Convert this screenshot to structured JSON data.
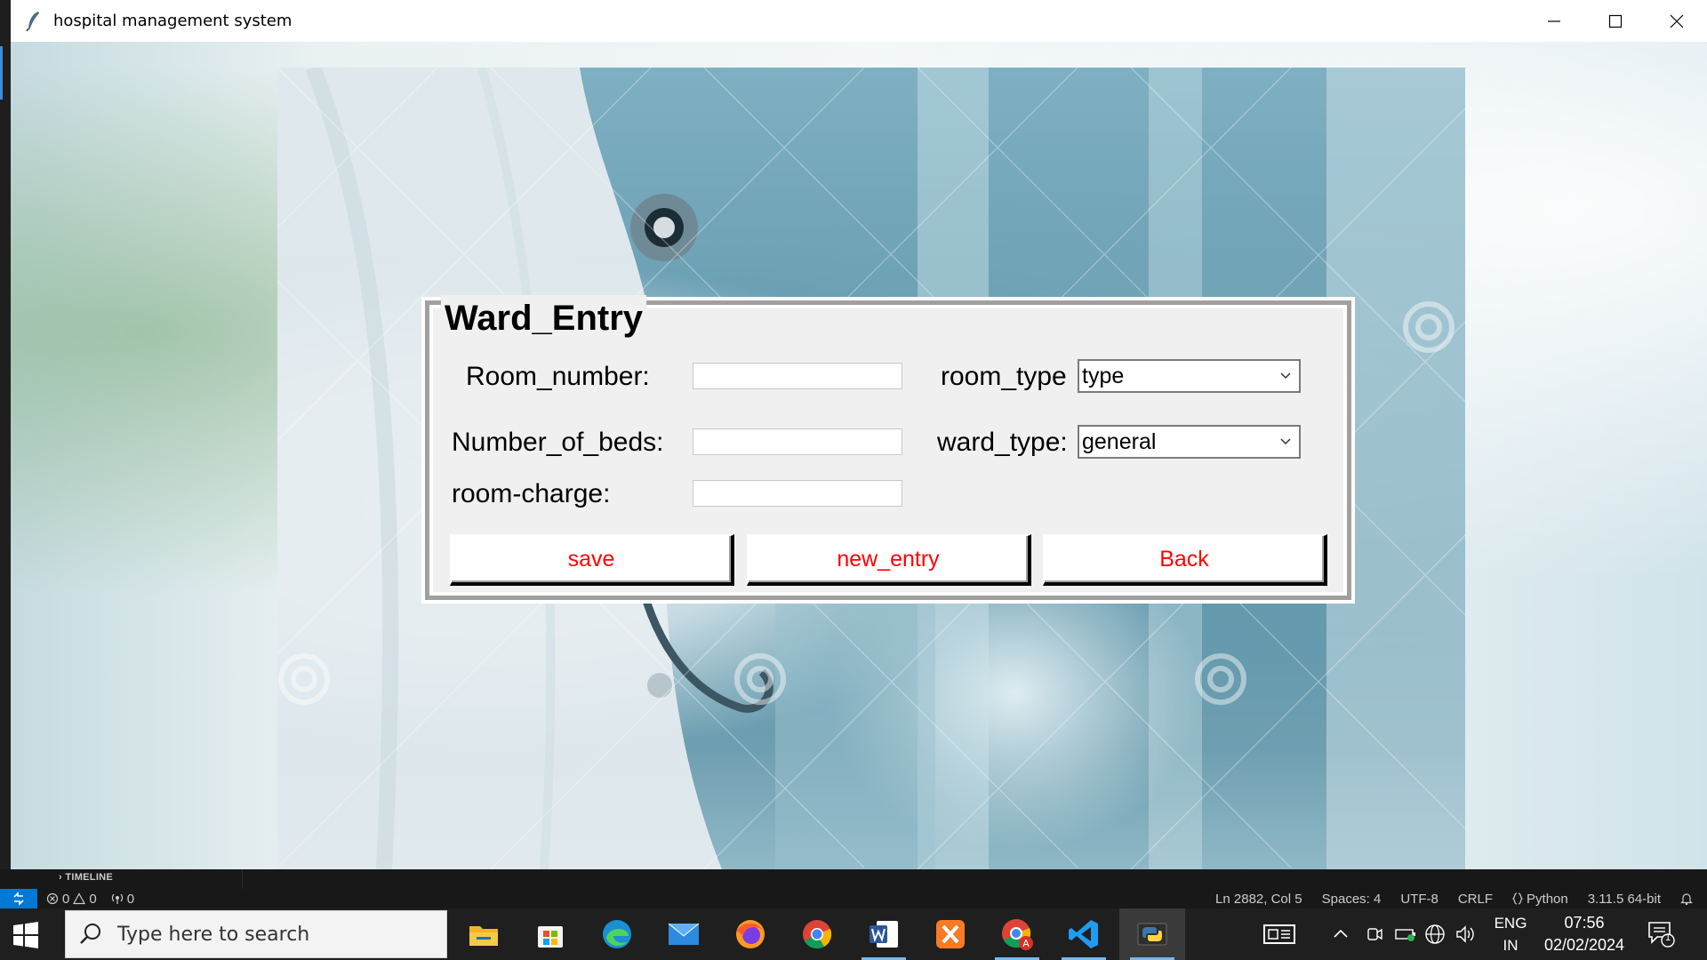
{
  "window": {
    "title": "hospital management system",
    "controls": [
      "minimize-icon",
      "maximize-icon",
      "close-icon"
    ]
  },
  "ward_entry": {
    "legend": "Ward_Entry",
    "labels": {
      "room_number": "Room_number:",
      "number_of_beds": "Number_of_beds:",
      "room_charge": "room-charge:",
      "room_type": "room_type",
      "ward_type": "ward_type:"
    },
    "fields": {
      "room_number": "",
      "number_of_beds": "",
      "room_charge": ""
    },
    "combos": {
      "room_type": "type",
      "ward_type": "general"
    },
    "buttons": {
      "save": "save",
      "new_entry": "new_entry",
      "back": "Back"
    },
    "colors": {
      "button_text": "#ff0000",
      "frame_bg": "#f0f0f0"
    }
  },
  "vscode": {
    "timeline_label": "TIMELINE",
    "errors": "0",
    "warnings": "0",
    "ports": "0",
    "cursor": "Ln 2882, Col 5",
    "spaces": "Spaces: 4",
    "encoding": "UTF-8",
    "eol": "CRLF",
    "language": "Python",
    "interpreter": "3.11.5 64-bit",
    "colors": {
      "remote": "#0078d4",
      "bar": "#181818"
    }
  },
  "taskbar": {
    "search_placeholder": "Type here to search",
    "apps": [
      "file-explorer-icon",
      "microsoft-store-icon",
      "edge-icon",
      "mail-icon",
      "firefox-icon",
      "chrome-icon",
      "word-icon",
      "xampp-icon",
      "chrome-profile-icon",
      "vscode-icon",
      "python-icon"
    ],
    "language_line1": "ENG",
    "language_line2": "IN",
    "time": "07:56",
    "date": "02/02/2024",
    "notifications": "1"
  }
}
